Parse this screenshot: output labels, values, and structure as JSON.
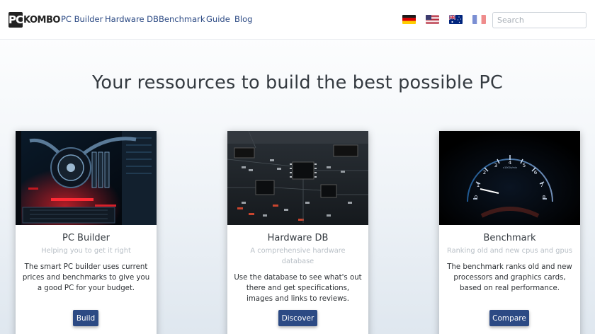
{
  "navbar": {
    "logo_mark": "PC",
    "logo_text": "KOMBO",
    "links": [
      "PC Builder",
      "Hardware DB",
      "Benchmark",
      "Guide",
      "Blog"
    ],
    "flags": [
      "germany-flag-icon",
      "usa-flag-icon",
      "australia-flag-icon",
      "france-flag-icon"
    ],
    "search_placeholder": "Search"
  },
  "hero": {
    "title": "Your ressources to build the best possible PC"
  },
  "cards": [
    {
      "title": "PC Builder",
      "subtitle": "Helping you to get it right",
      "text": "The smart PC builder uses current prices and benchmarks to give you a good PC for your budget.",
      "button": "Build"
    },
    {
      "title": "Hardware DB",
      "subtitle": "A comprehensive hardware database",
      "text": "Use the database to see what's out there and get specifications, images and links to reviews.",
      "button": "Discover"
    },
    {
      "title": "Benchmark",
      "subtitle": "Ranking old and new cpus and gpus",
      "text": "The benchmark ranks old and new processors and graphics cards, based on real performance.",
      "button": "Compare"
    }
  ],
  "gauge": {
    "ticks": [
      "0",
      "1",
      "2",
      "3",
      "4",
      "5",
      "6",
      "7",
      "8"
    ],
    "unit": "x1000r/min"
  },
  "colors": {
    "accent": "#2c4a84",
    "title": "#343a40",
    "subtitle": "#b8bfc6"
  }
}
